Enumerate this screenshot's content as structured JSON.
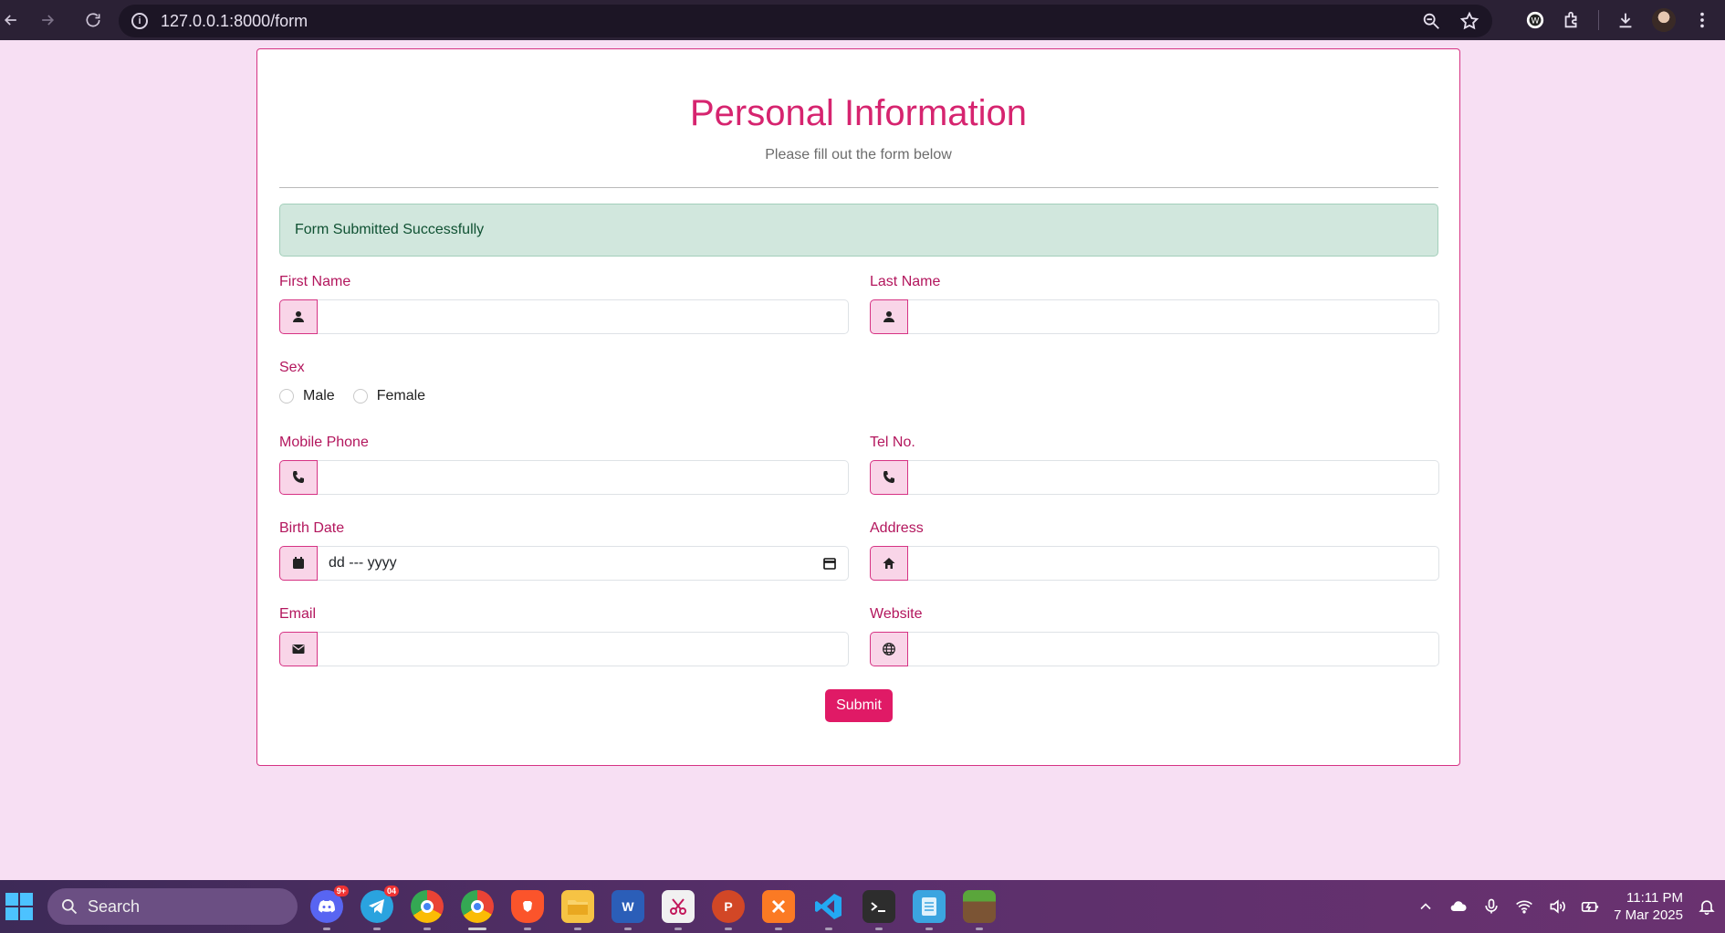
{
  "browser": {
    "url": "127.0.0.1:8000/form"
  },
  "form": {
    "title": "Personal Information",
    "subtitle": "Please fill out the form below",
    "alert": "Form Submitted Successfully",
    "first_name_label": "First Name",
    "last_name_label": "Last Name",
    "sex_label": "Sex",
    "sex_options": [
      "Male",
      "Female"
    ],
    "mobile_label": "Mobile Phone",
    "tel_label": "Tel No.",
    "birth_label": "Birth Date",
    "birth_placeholder": "dd --- yyyy",
    "address_label": "Address",
    "email_label": "Email",
    "website_label": "Website",
    "submit_label": "Submit"
  },
  "taskbar": {
    "search_placeholder": "Search",
    "discord_badge": "9+",
    "telegram_badge": "04",
    "word_letter": "W",
    "time": "11:11 PM",
    "date": "7 Mar 2025"
  },
  "colors": {
    "accent": "#d6246f",
    "button": "#e01a66",
    "page_bg": "#f7dff3",
    "alert_bg": "#d1e7dd"
  }
}
